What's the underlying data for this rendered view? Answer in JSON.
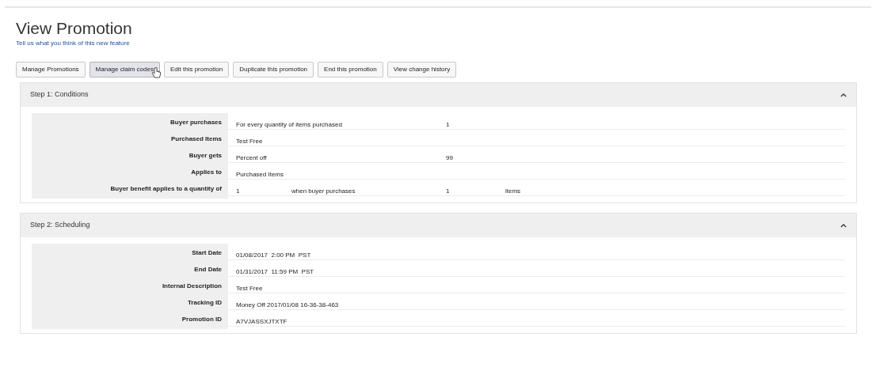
{
  "page": {
    "title": "View Promotion",
    "feedback_link": "Tell us what you think of this new feature"
  },
  "buttons": [
    {
      "label": "Manage Promotions",
      "hovered": false
    },
    {
      "label": "Manage claim codes",
      "hovered": true
    },
    {
      "label": "Edit this promotion",
      "hovered": false
    },
    {
      "label": "Duplicate this promotion",
      "hovered": false
    },
    {
      "label": "End this promotion",
      "hovered": false
    },
    {
      "label": "View change history",
      "hovered": false
    }
  ],
  "panels": [
    {
      "title": "Step 1: Conditions",
      "expanded": true,
      "rows": [
        {
          "label": "Buyer purchases",
          "values": [
            "For every quantity of items purchased",
            "1"
          ]
        },
        {
          "label": "Purchased Items",
          "values": [
            "Test Free"
          ]
        },
        {
          "label": "Buyer gets",
          "values": [
            "Percent off",
            "99"
          ]
        },
        {
          "label": "Applies to",
          "values": [
            "Purchased Items"
          ]
        },
        {
          "label": "Buyer benefit applies to a quantity of",
          "values": [
            "1",
            "when buyer purchases",
            "1",
            "items"
          ]
        }
      ]
    },
    {
      "title": "Step 2: Scheduling",
      "expanded": true,
      "rows": [
        {
          "label": "Start Date",
          "values": [
            "01/08/2017  2:00 PM  PST"
          ]
        },
        {
          "label": "End Date",
          "values": [
            "01/31/2017  11:59 PM  PST"
          ]
        },
        {
          "label": "Internal Description",
          "values": [
            "Test Free"
          ]
        },
        {
          "label": "Tracking ID",
          "values": [
            "Money Off 2017/01/08 16-36-38-463"
          ]
        },
        {
          "label": "Promotion ID",
          "values": [
            "A7VJASSXJTXTF"
          ]
        }
      ]
    }
  ]
}
